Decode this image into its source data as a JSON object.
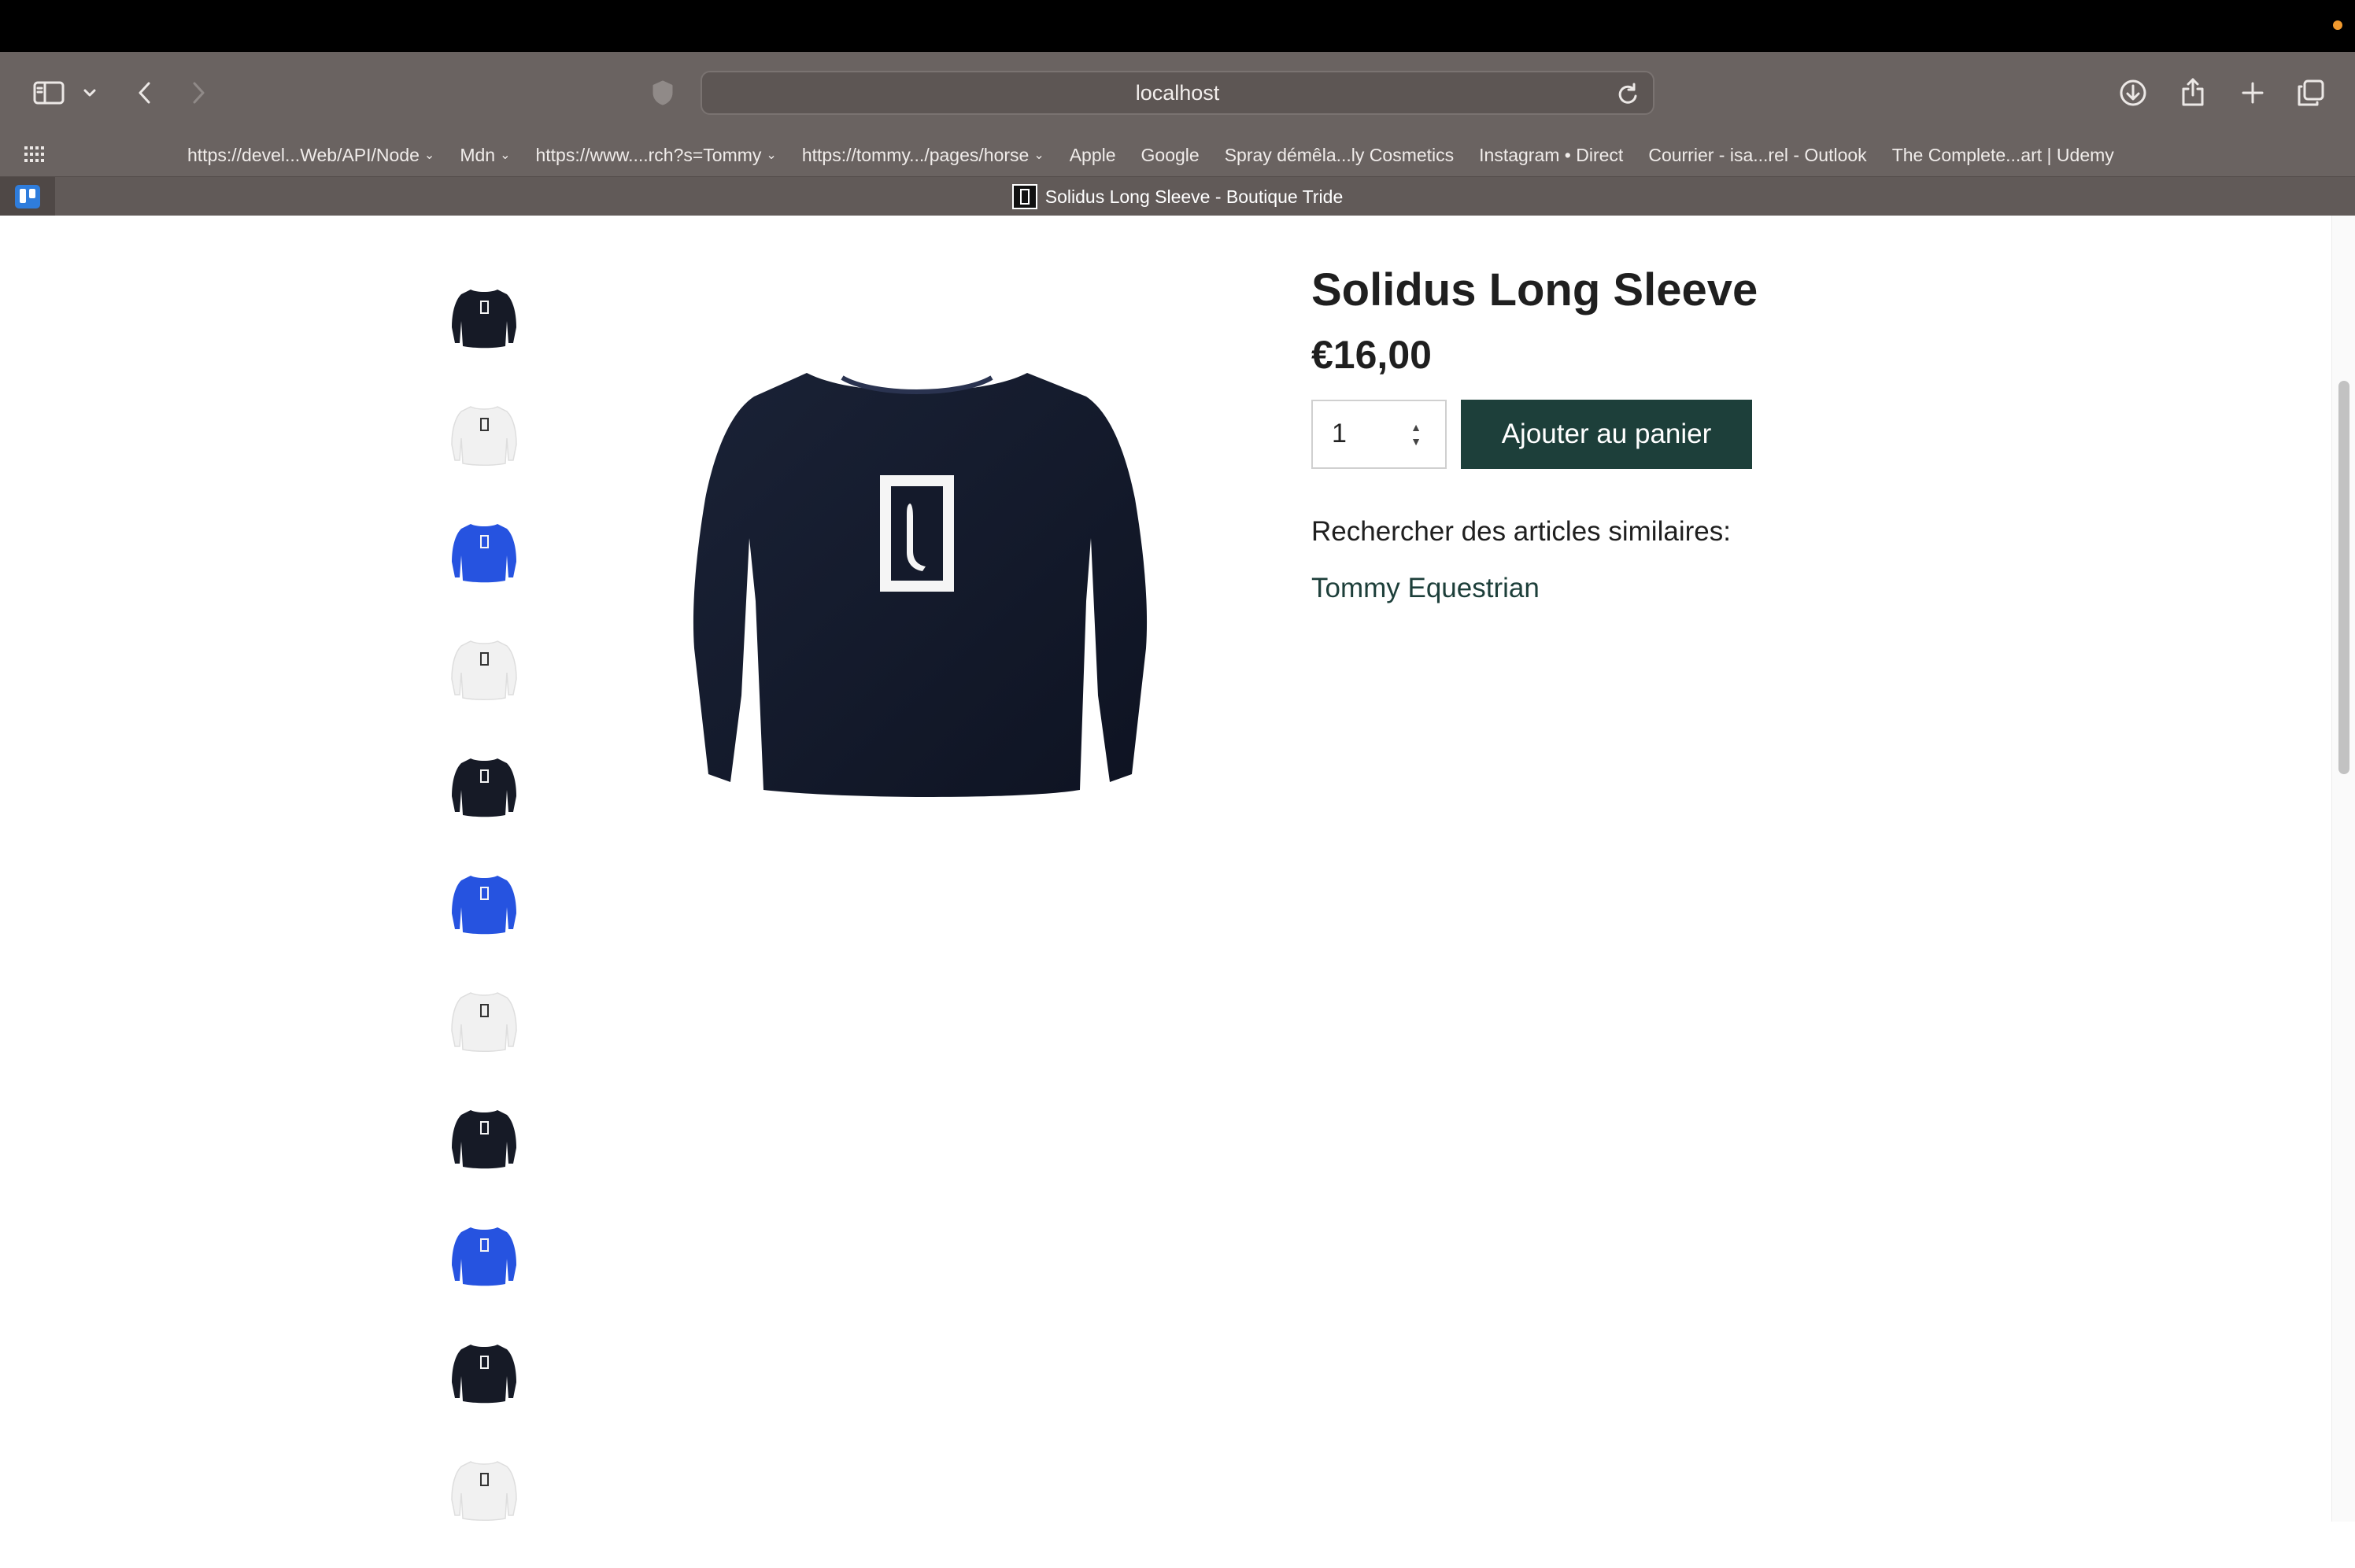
{
  "browser": {
    "url": "localhost",
    "tab_title": "Solidus Long Sleeve - Boutique Tride",
    "favorites": [
      {
        "label": "https://devel...Web/API/Node",
        "dropdown": true
      },
      {
        "label": "Mdn",
        "dropdown": true
      },
      {
        "label": "https://www....rch?s=Tommy",
        "dropdown": true
      },
      {
        "label": "https://tommy.../pages/horse",
        "dropdown": true
      },
      {
        "label": "Apple",
        "dropdown": false
      },
      {
        "label": "Google",
        "dropdown": false
      },
      {
        "label": "Spray démêla...ly Cosmetics",
        "dropdown": false
      },
      {
        "label": "Instagram • Direct",
        "dropdown": false
      },
      {
        "label": "Courrier - isa...rel - Outlook",
        "dropdown": false
      },
      {
        "label": "The Complete...art | Udemy",
        "dropdown": false
      }
    ],
    "icons": {
      "sidebar": "sidebar-icon",
      "back": "back-icon",
      "forward": "forward-icon",
      "privacy": "shield-icon",
      "reload": "reload-icon",
      "downloads": "download-icon",
      "share": "share-icon",
      "new_tab": "plus-icon",
      "tab_overview": "tabs-icon",
      "favorites_grid": "grid-icon"
    }
  },
  "product": {
    "title": "Solidus Long Sleeve",
    "price": "€16,00",
    "quantity": "1",
    "add_to_cart_label": "Ajouter au panier",
    "similar_label": "Rechercher des articles similaires:",
    "similar_link": "Tommy Equestrian",
    "thumbnails": [
      {
        "color": "#161a26"
      },
      {
        "color": "#f1f1f1"
      },
      {
        "color": "#2653e0"
      },
      {
        "color": "#f1f1f1"
      },
      {
        "color": "#161a26"
      },
      {
        "color": "#2653e0"
      },
      {
        "color": "#f1f1f1"
      },
      {
        "color": "#161a26"
      },
      {
        "color": "#2653e0"
      },
      {
        "color": "#161a26"
      },
      {
        "color": "#f1f1f1"
      }
    ],
    "main_image_color": "#141a2b"
  },
  "colors": {
    "accent": "#1d3f3a",
    "chrome": "#6a6361"
  }
}
